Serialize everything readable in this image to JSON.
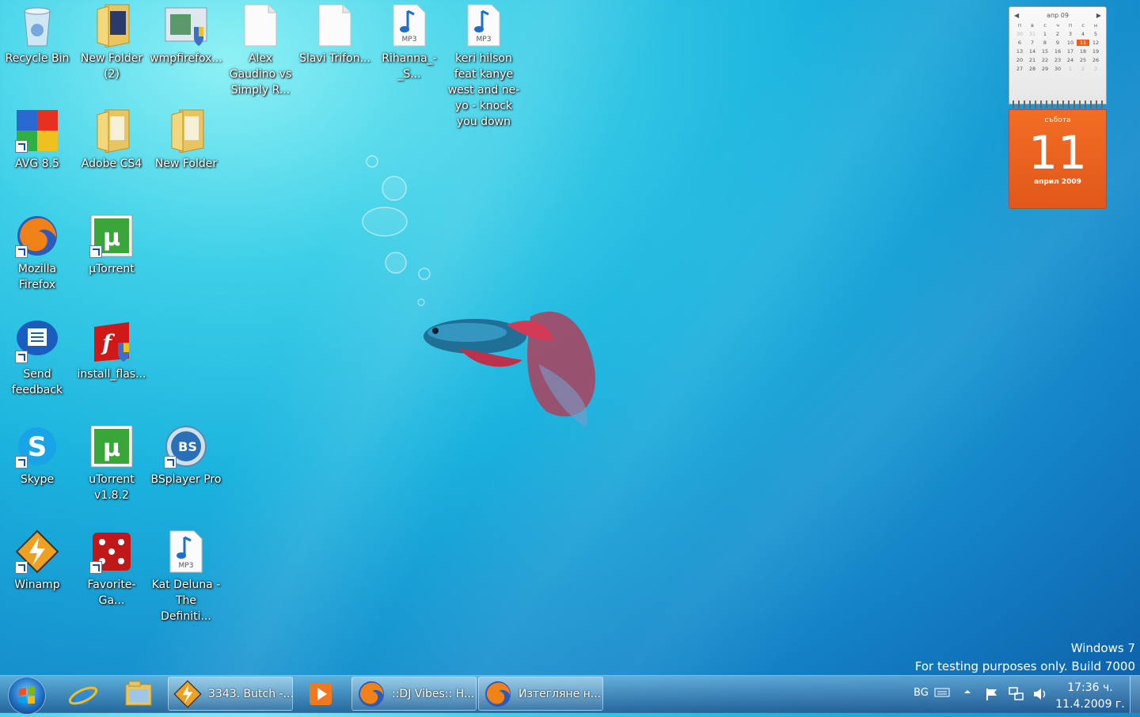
{
  "desktop": {
    "icons": [
      {
        "label": "Recycle Bin"
      },
      {
        "label": "New Folder (2)"
      },
      {
        "label": "wmpfirefox..."
      },
      {
        "label": "Alex Gaudino vs Simply R..."
      },
      {
        "label": "Slavi Trifon..."
      },
      {
        "label": "Rihanna_-_S..."
      },
      {
        "label": "keri hilson feat kanye west and ne-yo - knock you down"
      },
      {
        "label": "AVG 8.5"
      },
      {
        "label": "Adobe CS4"
      },
      {
        "label": "New Folder"
      },
      {
        "label": "Mozilla Firefox"
      },
      {
        "label": "µTorrent"
      },
      {
        "label": "Send feedback"
      },
      {
        "label": "install_flas..."
      },
      {
        "label": "Skype"
      },
      {
        "label": "uTorrent v1.8.2"
      },
      {
        "label": "BSplayer Pro"
      },
      {
        "label": "Winamp"
      },
      {
        "label": "Favorite-Ga..."
      },
      {
        "label": "Kat Deluna - The Definiti..."
      }
    ]
  },
  "calendar": {
    "month_label": "апр 09",
    "weekdays": [
      "п",
      "в",
      "с",
      "ч",
      "п",
      "с",
      "н"
    ],
    "days": [
      "30",
      "31",
      "1",
      "2",
      "3",
      "4",
      "5",
      "6",
      "7",
      "8",
      "9",
      "10",
      "11",
      "12",
      "13",
      "14",
      "15",
      "16",
      "17",
      "18",
      "19",
      "20",
      "21",
      "22",
      "23",
      "24",
      "25",
      "26",
      "27",
      "28",
      "29",
      "30",
      "1",
      "2",
      "3"
    ],
    "today_index": 12,
    "day_name": "събота",
    "day_number": "11",
    "month_year": "април 2009"
  },
  "watermark": {
    "line1": "Windows  7",
    "line2": "For testing purposes only. Build 7000"
  },
  "taskbar": {
    "tasks": [
      {
        "label": "3343. Butch -..."
      },
      {
        "label": "::DJ Vibes:: H..."
      },
      {
        "label": "Изтегляне н..."
      }
    ],
    "language": "BG",
    "time": "17:36 ч.",
    "date": "11.4.2009 г."
  },
  "colors": {
    "calendar_accent": "#e8601c",
    "mp3_note": "#1c6fd0"
  }
}
